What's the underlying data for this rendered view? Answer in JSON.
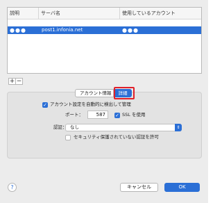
{
  "table": {
    "headers": [
      "説明",
      "サーバ名",
      "使用しているアカウント"
    ],
    "rows": [
      {
        "description": "●●●",
        "server": "post1.infonia.net",
        "account": "●●●"
      }
    ]
  },
  "buttons": {
    "add": "+",
    "remove": "−",
    "help": "?",
    "cancel": "キャンセル",
    "ok": "OK"
  },
  "tabs": {
    "account_info": "アカウント情報",
    "advanced": "詳細",
    "selected": "advanced"
  },
  "advanced": {
    "auto_detect_label": "アカウント設定を自動的に検出して管理",
    "auto_detect_checked": true,
    "port_label": "ポート：",
    "port_value": "587",
    "ssl_label": "SSL を使用",
    "ssl_checked": true,
    "auth_label": "認証：",
    "auth_value": "なし",
    "insecure_auth_label": "セキュリティ保護されていない認証を許可",
    "insecure_auth_checked": false
  },
  "colors": {
    "accent": "#2b6fd6",
    "highlight": "#e0202a"
  }
}
